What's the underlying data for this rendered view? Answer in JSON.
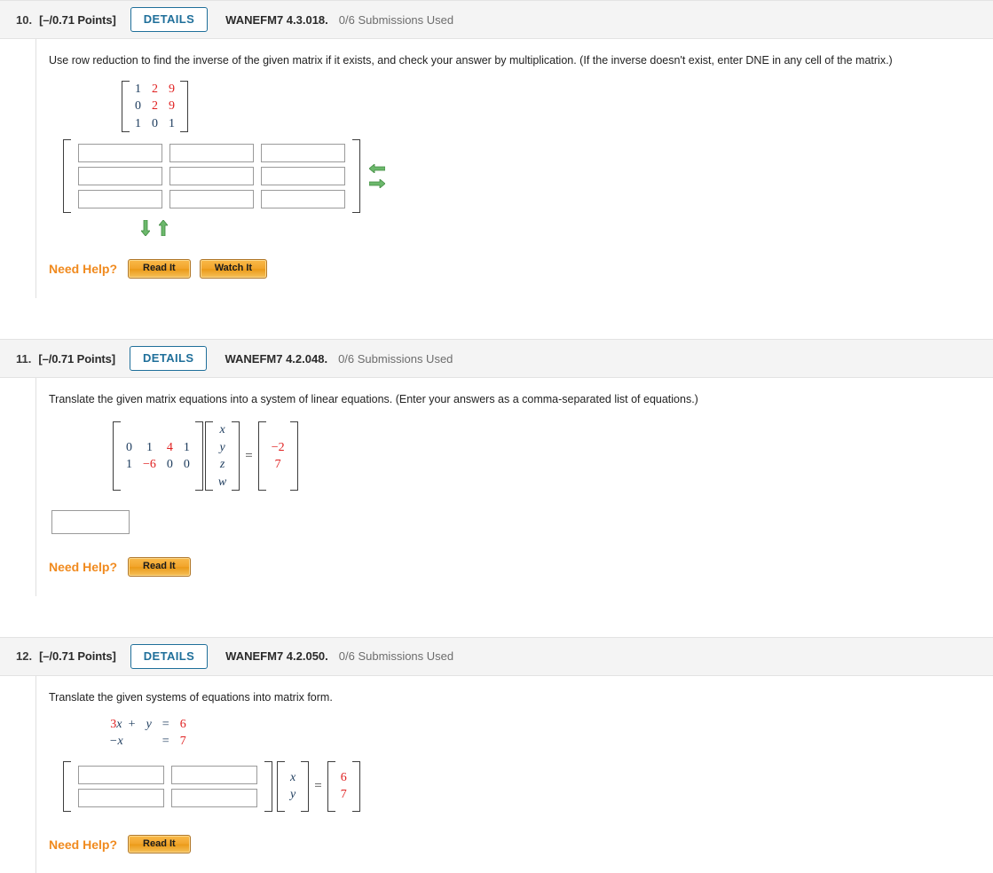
{
  "questions": [
    {
      "number": "10.",
      "points": "[–/0.71 Points]",
      "details_label": "DETAILS",
      "code": "WANEFM7 4.3.018.",
      "submissions": "0/6 Submissions Used",
      "prompt": "Use row reduction to find the inverse of the given matrix if it exists, and check your answer by multiplication. (If the inverse doesn't exist, enter DNE in any cell of the matrix.)",
      "given_matrix": {
        "rows": [
          [
            {
              "t": "1",
              "c": "dark"
            },
            {
              "t": "2",
              "c": "red"
            },
            {
              "t": "9",
              "c": "red"
            }
          ],
          [
            {
              "t": "0",
              "c": "dark"
            },
            {
              "t": "2",
              "c": "red"
            },
            {
              "t": "9",
              "c": "red"
            }
          ],
          [
            {
              "t": "1",
              "c": "dark"
            },
            {
              "t": "0",
              "c": "dark"
            },
            {
              "t": "1",
              "c": "dark"
            }
          ]
        ]
      },
      "answer_grid": {
        "rows": 3,
        "cols": 3,
        "values": [
          "",
          "",
          "",
          "",
          "",
          "",
          "",
          "",
          ""
        ]
      },
      "arrows": [
        "arrow-left",
        "arrow-right",
        "arrow-down",
        "arrow-up"
      ],
      "need_help_label": "Need Help?",
      "help_buttons": [
        "Read It",
        "Watch It"
      ]
    },
    {
      "number": "11.",
      "points": "[–/0.71 Points]",
      "details_label": "DETAILS",
      "code": "WANEFM7 4.2.048.",
      "submissions": "0/6 Submissions Used",
      "prompt": "Translate the given matrix equations into a system of linear equations. (Enter your answers as a comma-separated list of equations.)",
      "coeff_matrix": {
        "rows": [
          [
            {
              "t": "0",
              "c": "dark"
            },
            {
              "t": "1",
              "c": "dark"
            },
            {
              "t": "4",
              "c": "red"
            },
            {
              "t": "1",
              "c": "dark"
            }
          ],
          [
            {
              "t": "1",
              "c": "dark"
            },
            {
              "t": "−6",
              "c": "red"
            },
            {
              "t": "0",
              "c": "dark"
            },
            {
              "t": "0",
              "c": "dark"
            }
          ]
        ]
      },
      "variable_vector": [
        "x",
        "y",
        "z",
        "w"
      ],
      "equals": "=",
      "result_vector": [
        {
          "t": "−2",
          "c": "red"
        },
        {
          "t": "7",
          "c": "red"
        }
      ],
      "answer_value": "",
      "need_help_label": "Need Help?",
      "help_buttons": [
        "Read It"
      ]
    },
    {
      "number": "12.",
      "points": "[–/0.71 Points]",
      "details_label": "DETAILS",
      "code": "WANEFM7 4.2.050.",
      "submissions": "0/6 Submissions Used",
      "prompt": "Translate the given systems of equations into matrix form.",
      "system": [
        [
          {
            "t": "3",
            "c": "red"
          },
          {
            "t": "x",
            "c": "var"
          },
          {
            "t": "+",
            "c": "op"
          },
          {
            "t": "y",
            "c": "var"
          },
          {
            "t": "=",
            "c": "op"
          },
          {
            "t": "6",
            "c": "red"
          }
        ],
        [
          {
            "t": "",
            "c": "op"
          },
          {
            "t": "−x",
            "c": "var"
          },
          {
            "t": "",
            "c": "op"
          },
          {
            "t": "",
            "c": "op"
          },
          {
            "t": "=",
            "c": "op"
          },
          {
            "t": "7",
            "c": "red"
          }
        ]
      ],
      "answer_grid": {
        "rows": 2,
        "cols": 2,
        "values": [
          "",
          "",
          "",
          ""
        ]
      },
      "variable_vector": [
        "x",
        "y"
      ],
      "equals": "=",
      "result_vector": [
        {
          "t": "6",
          "c": "red"
        },
        {
          "t": "7",
          "c": "red"
        }
      ],
      "need_help_label": "Need Help?",
      "help_buttons": [
        "Read It"
      ]
    }
  ],
  "colors": {
    "accent_blue": "#1f6f9a",
    "number_dark": "#1b3a5c",
    "number_red": "#e02020",
    "help_orange": "#f08a1e",
    "arrow_green": "#5fa85f",
    "header_bg": "#f4f4f4"
  }
}
